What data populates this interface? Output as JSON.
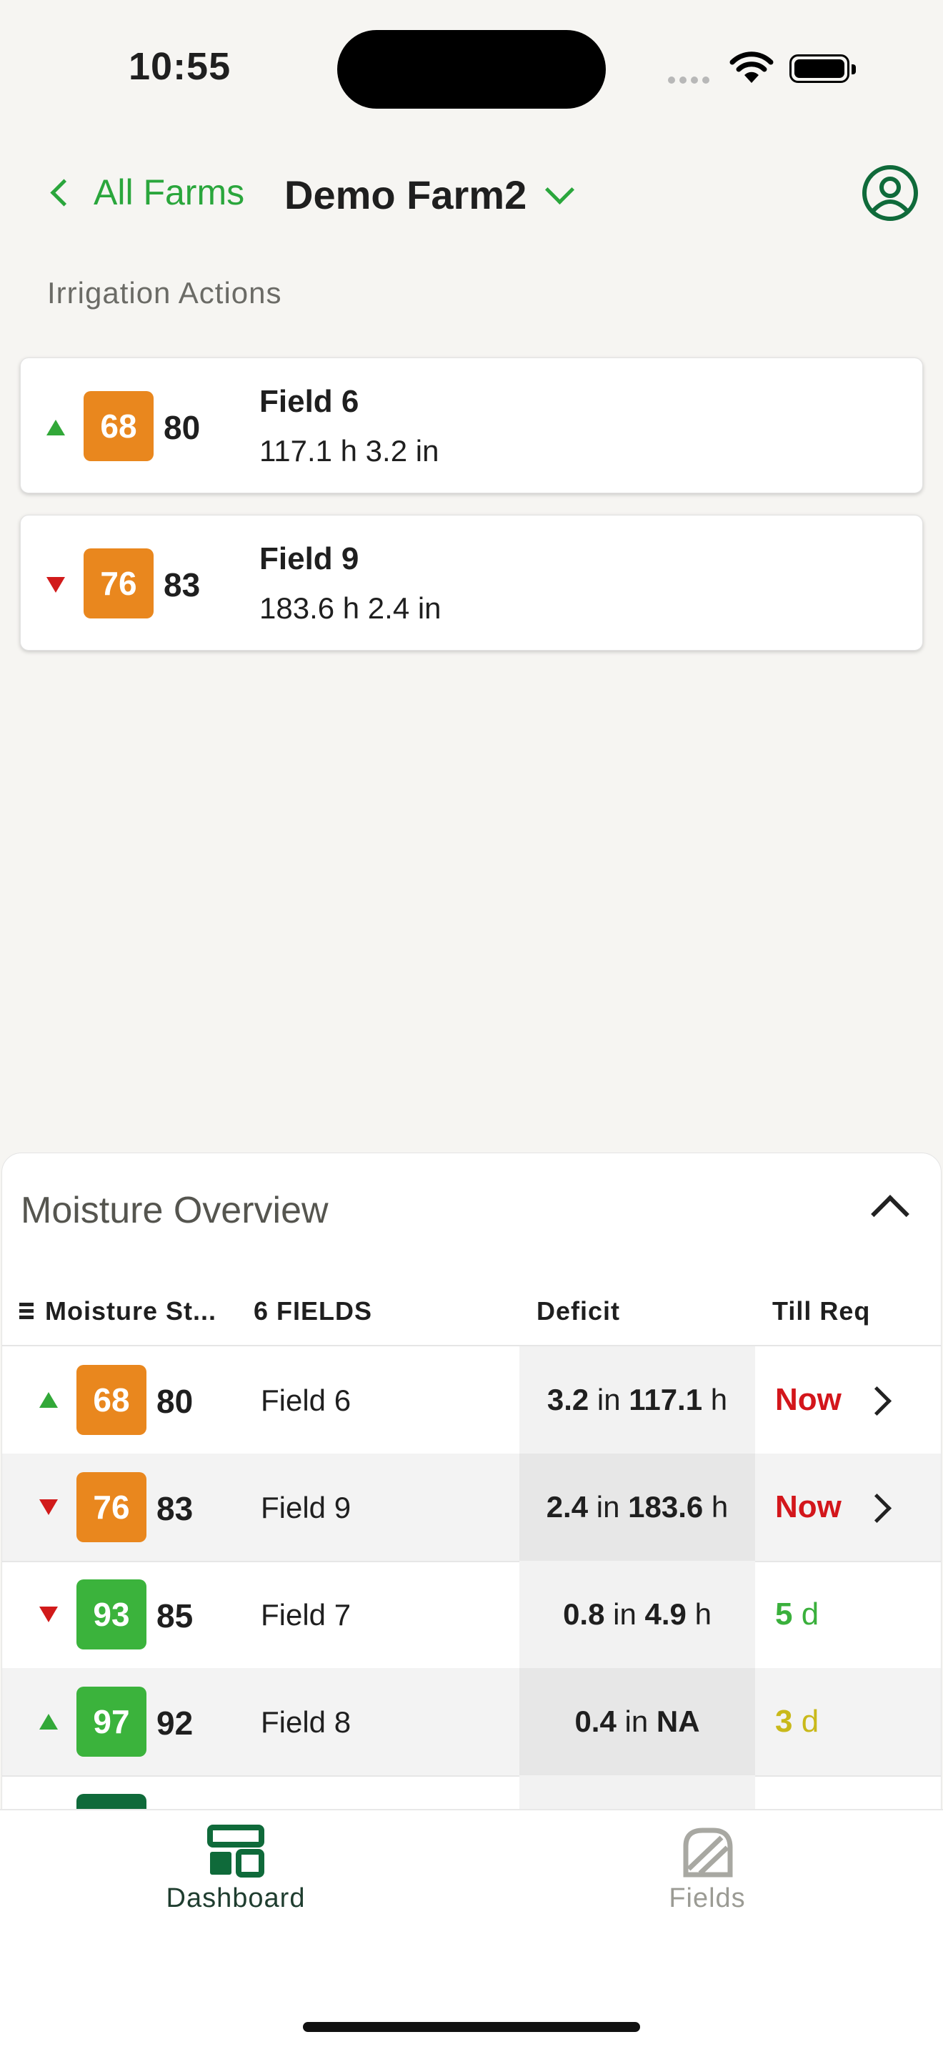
{
  "status_bar": {
    "time": "10:55"
  },
  "nav": {
    "back_label": "All Farms",
    "farm_name": "Demo Farm2"
  },
  "irrigation": {
    "section_label": "Irrigation Actions",
    "cards": [
      {
        "trend": "up",
        "current": "68",
        "target": "80",
        "field": "Field 6",
        "detail": "117.1 h 3.2 in",
        "badge_color": "#e9871e"
      },
      {
        "trend": "down",
        "current": "76",
        "target": "83",
        "field": "Field 9",
        "detail": "183.6 h 2.4 in",
        "badge_color": "#e9871e"
      }
    ]
  },
  "overview": {
    "title": "Moisture Overview",
    "headers": {
      "status": "Moisture St...",
      "fields": "6 FIELDS",
      "deficit": "Deficit",
      "till": "Till Req"
    },
    "rows": [
      {
        "trend": "up",
        "current": "68",
        "target": "80",
        "field": "Field 6",
        "deficit_in": "3.2",
        "deficit_in_unit": "in",
        "deficit_h": "117.1",
        "deficit_h_unit": "h",
        "till_value": "Now",
        "till_unit": ""
      },
      {
        "trend": "down",
        "current": "76",
        "target": "83",
        "field": "Field 9",
        "deficit_in": "2.4",
        "deficit_in_unit": "in",
        "deficit_h": "183.6",
        "deficit_h_unit": "h",
        "till_value": "Now",
        "till_unit": ""
      },
      {
        "trend": "down",
        "current": "93",
        "target": "85",
        "field": "Field 7",
        "deficit_in": "0.8",
        "deficit_in_unit": "in",
        "deficit_h": "4.9",
        "deficit_h_unit": "h",
        "till_value": "5",
        "till_unit": "d"
      },
      {
        "trend": "up",
        "current": "97",
        "target": "92",
        "field": "Field 8",
        "deficit_in": "0.4",
        "deficit_in_unit": "in",
        "deficit_h": "NA",
        "deficit_h_unit": "",
        "till_value": "3",
        "till_unit": "d"
      }
    ]
  },
  "tabs": {
    "dashboard": "Dashboard",
    "fields": "Fields"
  },
  "colors": {
    "accent": "#2aa63c",
    "urgent": "#d3161b",
    "warn_badge": "#e9871e",
    "ok_badge": "#3bb33c",
    "tab_active": "#0f6a3a"
  }
}
